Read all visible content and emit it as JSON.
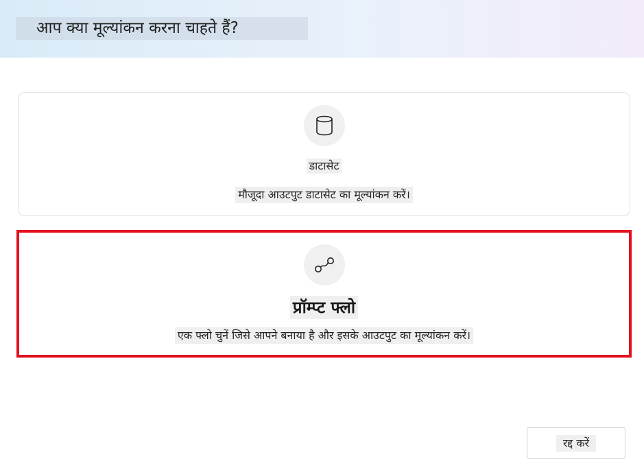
{
  "header": {
    "title": "आप क्या मूल्यांकन करना चाहते हैं?"
  },
  "options": [
    {
      "icon": "database-icon",
      "title": "डाटासेट",
      "description": "मौजूदा आउटपुट डाटासेट का मूल्यांकन करें।"
    },
    {
      "icon": "flow-icon",
      "title": "प्रॉम्प्ट फ्लो",
      "description": "एक फ्लो चुनें जिसे आपने बनाया है और इसके आउटपुट का मूल्यांकन करें।",
      "highlighted": true,
      "highlight_color": "#e3111e"
    }
  ],
  "footer": {
    "cancel_label": "रद्द करें"
  }
}
